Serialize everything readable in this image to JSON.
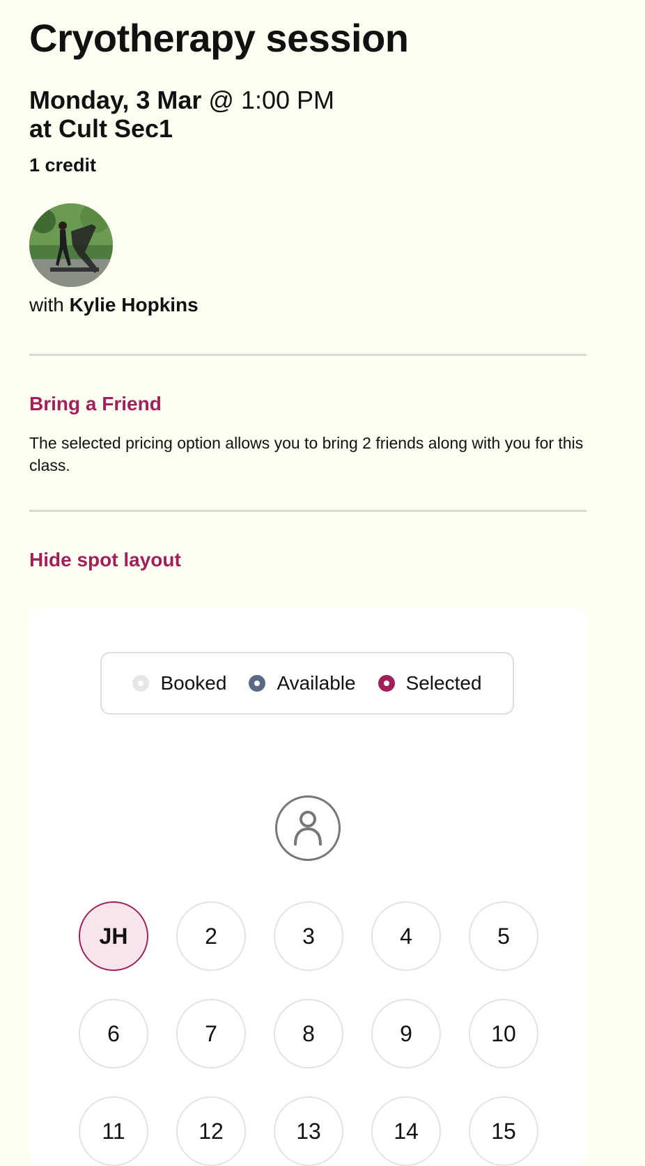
{
  "session": {
    "title": "Cryotherapy session",
    "date": "Monday, 3 Mar",
    "at_symbol": " @ ",
    "time": "1:00 PM",
    "location": "at Cult Sec1",
    "credits": "1 credit"
  },
  "instructor": {
    "prefix": "with ",
    "name": "Kylie Hopkins"
  },
  "bring_friend": {
    "title": "Bring a Friend",
    "description": "The selected pricing option allows you to bring 2 friends along with you for this class."
  },
  "spot_layout": {
    "toggle_label": "Hide spot layout",
    "legend": {
      "booked": "Booked",
      "available": "Available",
      "selected": "Selected"
    },
    "spots": [
      {
        "label": "JH",
        "state": "selected"
      },
      {
        "label": "2",
        "state": "available"
      },
      {
        "label": "3",
        "state": "available"
      },
      {
        "label": "4",
        "state": "available"
      },
      {
        "label": "5",
        "state": "available"
      },
      {
        "label": "6",
        "state": "available"
      },
      {
        "label": "7",
        "state": "available"
      },
      {
        "label": "8",
        "state": "available"
      },
      {
        "label": "9",
        "state": "available"
      },
      {
        "label": "10",
        "state": "available"
      },
      {
        "label": "11",
        "state": "available"
      },
      {
        "label": "12",
        "state": "available"
      },
      {
        "label": "13",
        "state": "available"
      },
      {
        "label": "14",
        "state": "available"
      },
      {
        "label": "15",
        "state": "available"
      }
    ]
  },
  "colors": {
    "accent": "#a0215a",
    "available": "#5b6a82",
    "booked": "#e6e6e6",
    "background": "#fefef3"
  }
}
